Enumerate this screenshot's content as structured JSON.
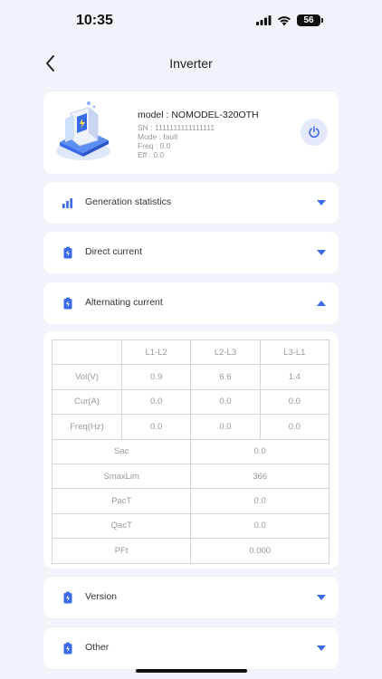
{
  "status_bar": {
    "time": "10:35",
    "battery": "56"
  },
  "nav": {
    "title": "Inverter"
  },
  "device": {
    "model": "model : NOMODEL-320OTH",
    "sn": "SN : 1111111111111111",
    "mode": "Mode : fault",
    "freq": "Freq : 0.0",
    "eff": "Eff : 0.0"
  },
  "sections": {
    "generation": "Generation statistics",
    "dc": "Direct current",
    "ac": "Alternating current",
    "version": "Version",
    "other": "Other"
  },
  "ac_table": {
    "headers": [
      "",
      "L1-L2",
      "L2-L3",
      "L3-L1"
    ],
    "rows": [
      {
        "label": "Vol(V)",
        "values": [
          "0.9",
          "6.6",
          "1.4"
        ]
      },
      {
        "label": "Cur(A)",
        "values": [
          "0.0",
          "0.0",
          "0.0"
        ]
      },
      {
        "label": "Freq(Hz)",
        "values": [
          "0.0",
          "0.0",
          "0.0"
        ]
      }
    ],
    "pairs": [
      {
        "label": "Sac",
        "value": "0.0"
      },
      {
        "label": "SmaxLim",
        "value": "366"
      },
      {
        "label": "PacT",
        "value": "0.0"
      },
      {
        "label": "QacT",
        "value": "0.0"
      },
      {
        "label": "PFt",
        "value": "0.000"
      }
    ]
  },
  "colors": {
    "accent": "#3b6ae8",
    "background": "#f1f3fb"
  }
}
